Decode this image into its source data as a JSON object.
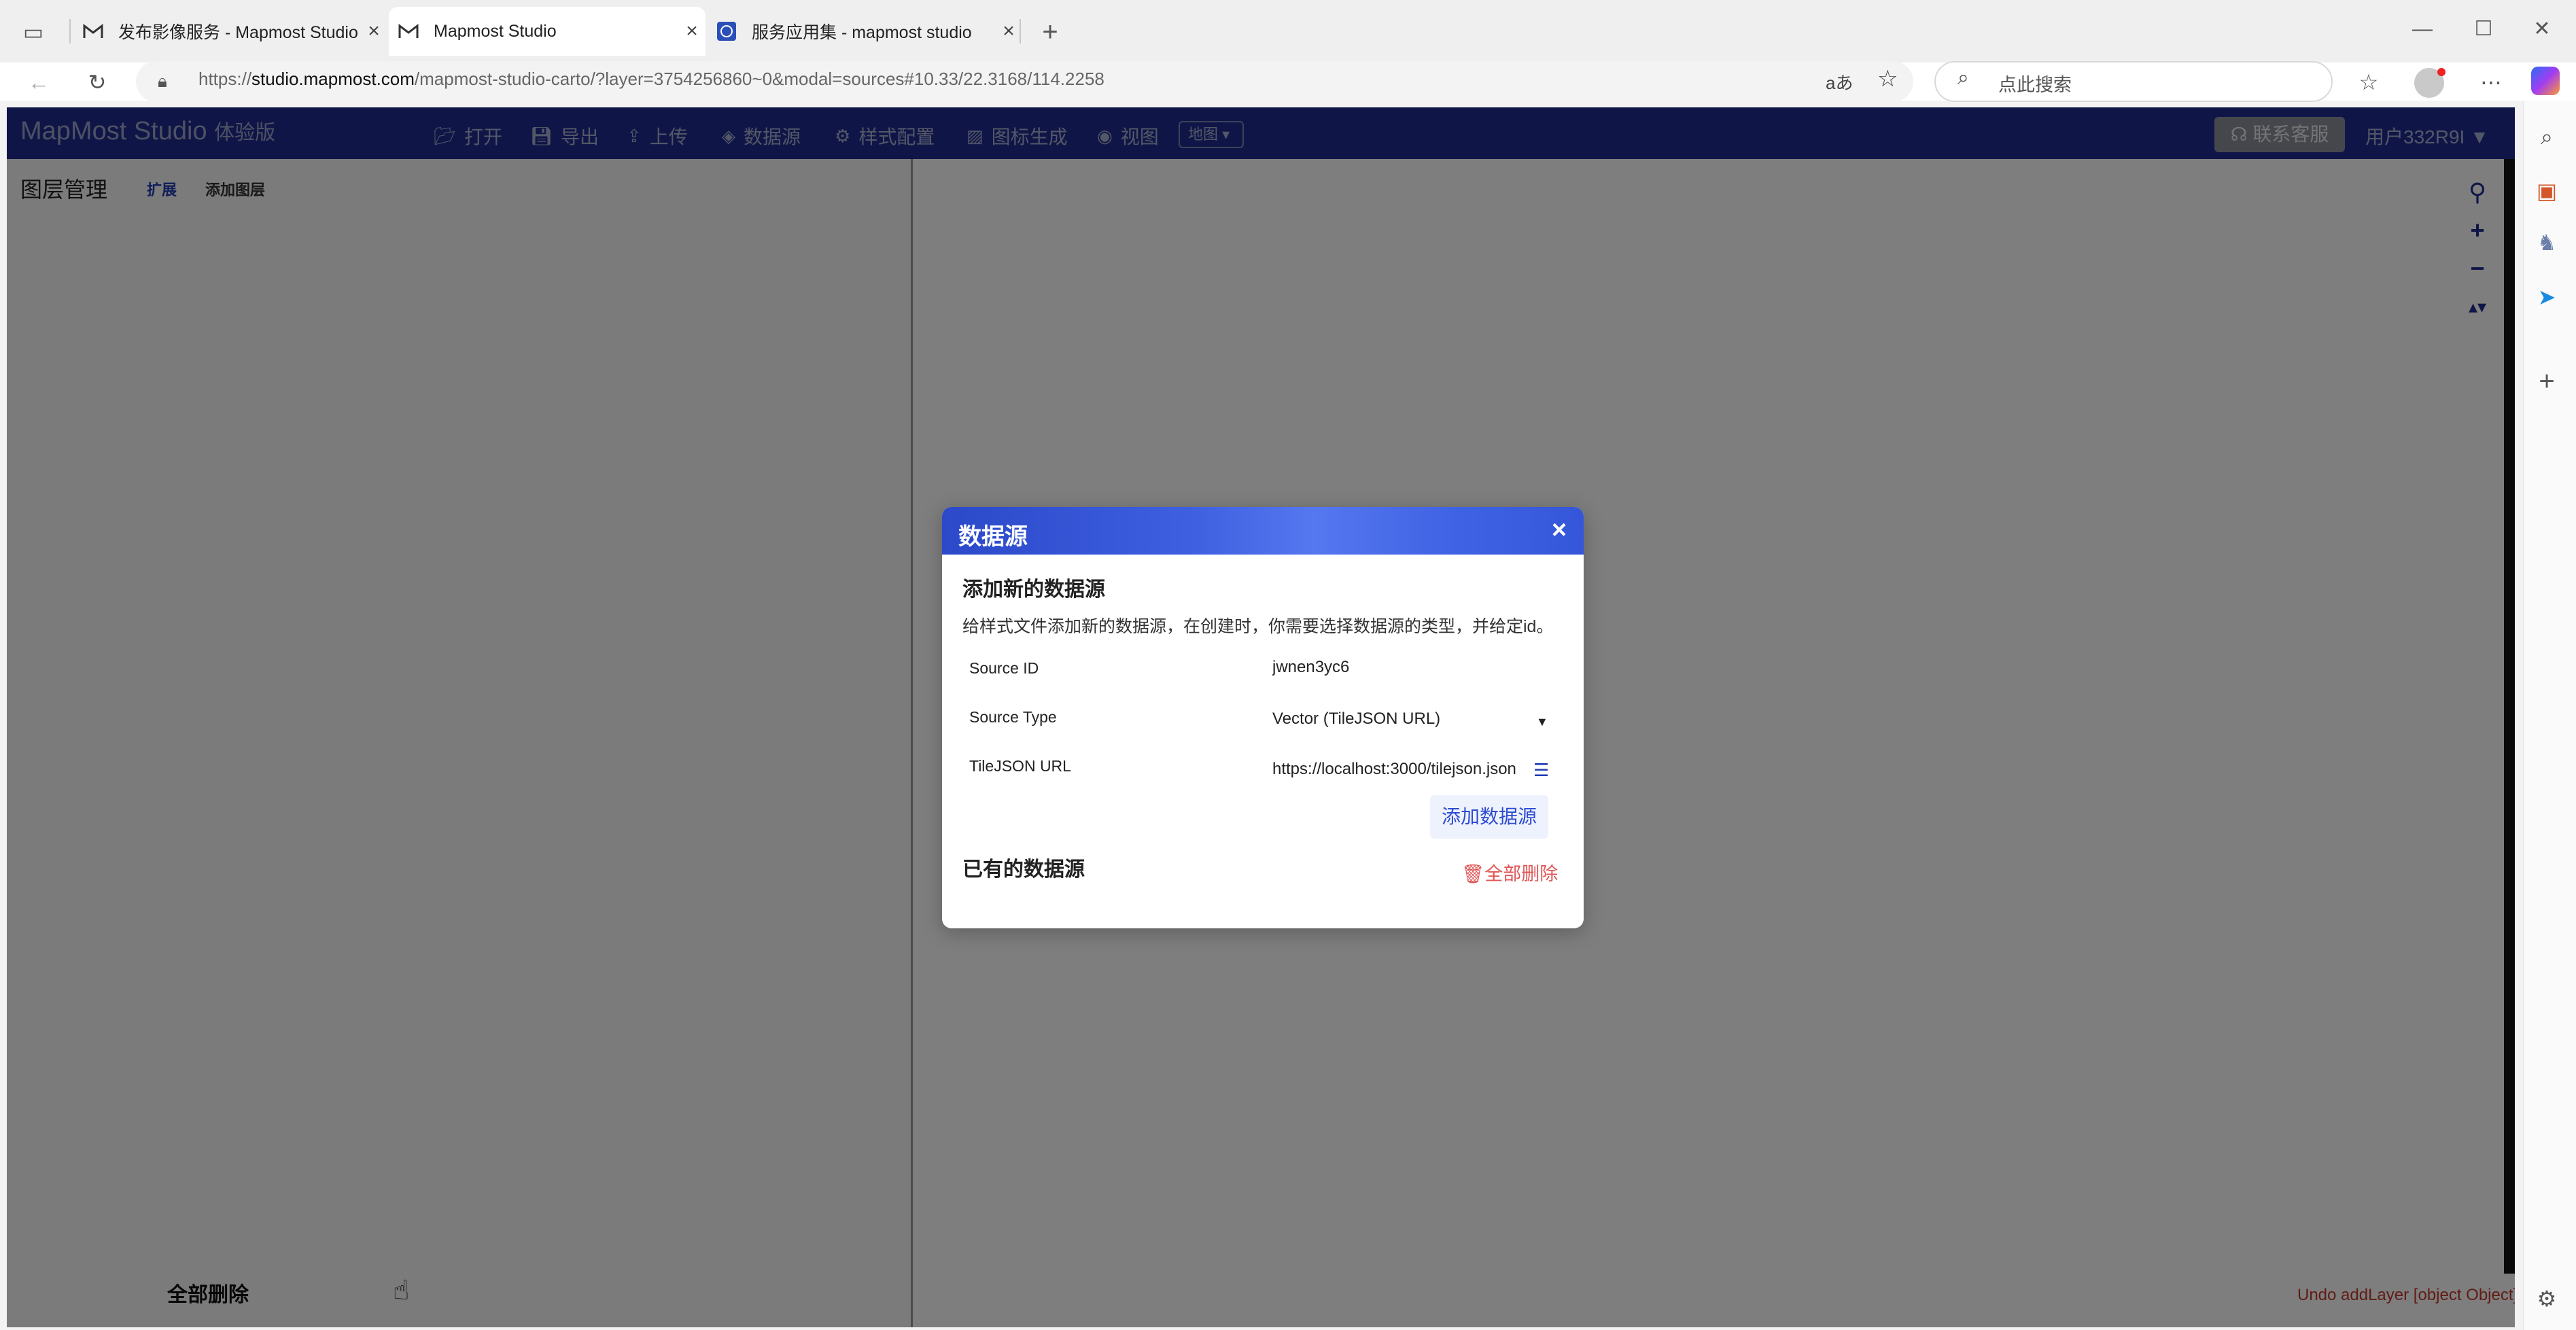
{
  "browser": {
    "tabs": [
      {
        "title": "发布影像服务 - Mapmost Studio",
        "icon": "mapmost-m-icon"
      },
      {
        "title": "Mapmost Studio",
        "icon": "mapmost-m-icon"
      },
      {
        "title": "服务应用集 - mapmost studio",
        "icon": "globe-app-icon"
      }
    ],
    "url_prefix": "https://",
    "url_host": "studio.mapmost.com",
    "url_rest": "/mapmost-studio-carto/?layer=3754256860~0&modal=sources#10.33/22.3168/114.2258",
    "search_placeholder": "点此搜索",
    "translate_glyph": "aあ"
  },
  "app": {
    "logo": {
      "brand": "MapMost Studio",
      "edition": "体验版"
    },
    "menu": [
      {
        "label": "打开",
        "icon": "folder-open-icon"
      },
      {
        "label": "导出",
        "icon": "save-icon"
      },
      {
        "label": "上传",
        "icon": "upload-icon"
      },
      {
        "label": "数据源",
        "icon": "layers-icon"
      },
      {
        "label": "样式配置",
        "icon": "gear-icon"
      },
      {
        "label": "图标生成",
        "icon": "image-icon"
      },
      {
        "label": "视图",
        "icon": "eye-icon"
      }
    ],
    "view_select": "地图",
    "support": "联系客服",
    "user": "用户332R9I",
    "left_panel": {
      "title": "图层管理",
      "expand": "扩展",
      "add_layer": "添加图层",
      "delete_all": "全部删除"
    },
    "undo_text": "Undo addLayer [object Object]"
  },
  "modal": {
    "title": "数据源",
    "add_section_title": "添加新的数据源",
    "description": "给样式文件添加新的数据源，在创建时，你需要选择数据源的类型，并给定id。",
    "fields": {
      "source_id_label": "Source ID",
      "source_id_value": "jwnen3yc6",
      "source_type_label": "Source Type",
      "source_type_value": "Vector (TileJSON URL)",
      "tilejson_label": "TileJSON URL",
      "tilejson_value": "https://localhost:3000/tilejson.json"
    },
    "add_button": "添加数据源",
    "existing_title": "已有的数据源",
    "delete_all": "全部删除"
  },
  "colors": {
    "app_header": "#1f2d8e",
    "modal_header": "#3d5fe0",
    "danger": "#e05555",
    "link": "#1f3bb3"
  }
}
